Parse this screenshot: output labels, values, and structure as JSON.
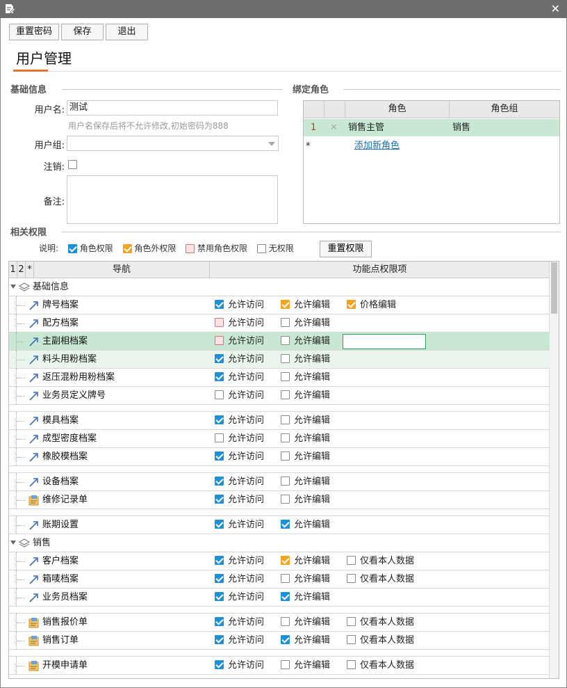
{
  "toolbar": {
    "reset_password": "重置密码",
    "save": "保存",
    "exit": "退出"
  },
  "page_title": "用户管理",
  "basic_info": {
    "title": "基础信息",
    "username_label": "用户名:",
    "username_value": "测试",
    "username_hint": "用户名保存后将不允许修改,初始密码为888",
    "group_label": "用户组:",
    "group_value": "",
    "cancel_label": "注销:",
    "remark_label": "备注:",
    "remark_value": ""
  },
  "roles": {
    "title": "绑定角色",
    "col_role": "角色",
    "col_group": "角色组",
    "rows": [
      {
        "num": "1",
        "role": "销售主管",
        "group": "销售"
      }
    ],
    "new_row_marker": "*",
    "add_link": "添加新角色"
  },
  "permissions": {
    "title": "相关权限",
    "legend_label": "说明:",
    "legend": {
      "role": "角色权限",
      "extra": "角色外权限",
      "banned": "禁用角色权限",
      "none": "无权限"
    },
    "reset_button": "重置权限",
    "head": {
      "c1": "1",
      "c2": "2",
      "c3": "*",
      "nav": "导航",
      "perms": "功能点权限项"
    },
    "group1": "基础信息",
    "group2": "销售",
    "labels": {
      "access": "允许访问",
      "edit": "允许编辑",
      "price": "价格编辑",
      "own": "仅看本人数据"
    },
    "items": [
      {
        "name": "牌号档案"
      },
      {
        "name": "配方档案"
      },
      {
        "name": "主副相档案"
      },
      {
        "name": "料头用粉档案"
      },
      {
        "name": "返压混粉用粉档案"
      },
      {
        "name": "业务员定义牌号"
      },
      {
        "name": "模具档案"
      },
      {
        "name": "成型密度档案"
      },
      {
        "name": "橡胶模档案"
      },
      {
        "name": "设备档案"
      },
      {
        "name": "维修记录单"
      },
      {
        "name": "账期设置"
      },
      {
        "name": "客户档案"
      },
      {
        "name": "箱唛档案"
      },
      {
        "name": "业务员档案"
      },
      {
        "name": "销售报价单"
      },
      {
        "name": "销售订单"
      },
      {
        "name": "开模申请单"
      }
    ]
  }
}
